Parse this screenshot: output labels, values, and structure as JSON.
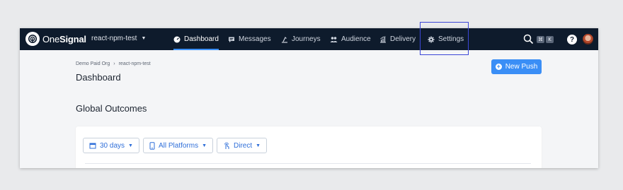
{
  "brand": {
    "name_light": "One",
    "name_bold": "Signal",
    "logo": "onesignal-logo-icon"
  },
  "app_selector": {
    "value": "react-npm-test"
  },
  "nav": [
    {
      "label": "Dashboard",
      "icon": "dashboard-icon",
      "active": true
    },
    {
      "label": "Messages",
      "icon": "message-icon",
      "active": false
    },
    {
      "label": "Journeys",
      "icon": "journeys-icon",
      "active": false
    },
    {
      "label": "Audience",
      "icon": "audience-icon",
      "active": false
    },
    {
      "label": "Delivery",
      "icon": "delivery-icon",
      "active": false
    },
    {
      "label": "Settings",
      "icon": "gear-icon",
      "active": false
    }
  ],
  "search_shortcut": {
    "keys": [
      "⌘",
      "K"
    ]
  },
  "help_icon_label": "?",
  "breadcrumb": [
    "Demo Paid Org",
    "react-npm-test"
  ],
  "page_title": "Dashboard",
  "new_push_label": "New Push",
  "section_title": "Global Outcomes",
  "filters": [
    {
      "label": "30 days",
      "icon": "calendar-icon"
    },
    {
      "label": "All Platforms",
      "icon": "phone-icon"
    },
    {
      "label": "Direct",
      "icon": "touch-icon"
    }
  ],
  "colors": {
    "nav_bg": "#0e1b2c",
    "accent": "#3a8ef6",
    "highlight": "#3b46d6"
  }
}
